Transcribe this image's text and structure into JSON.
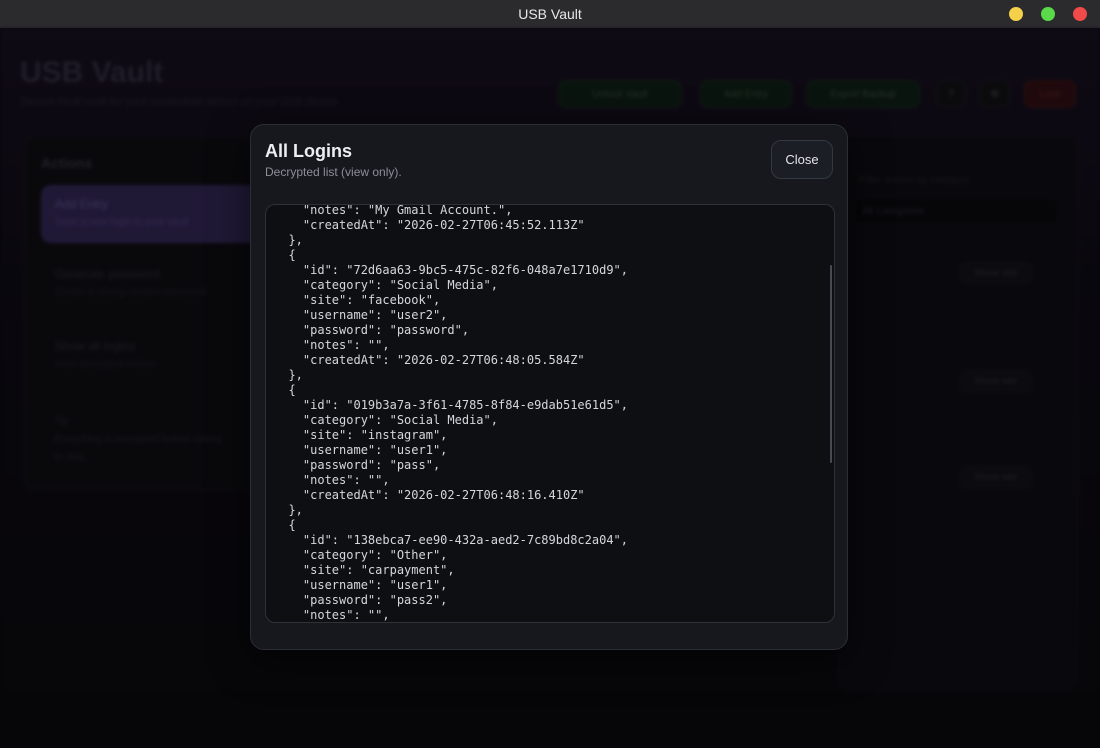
{
  "window": {
    "title": "USB Vault"
  },
  "background": {
    "brand": "USB Vault",
    "tagline": "Secure local vault for your credentials stored on your USB device",
    "header_buttons": [
      "Unlock Vault",
      "Add Entry",
      "Export Backup",
      "?",
      "⚙",
      "Lock"
    ],
    "left_panel": {
      "heading": "Actions",
      "active_item": {
        "title": "Add Entry",
        "subtitle": "Save a new login to your vault"
      },
      "items": [
        {
          "title": "Generate password",
          "subtitle": "Create a strong random password"
        },
        {
          "title": "Show all logins",
          "subtitle": "View decrypted entries"
        }
      ],
      "note": [
        "Tip",
        "Everything is encrypted before saving",
        "to disk."
      ]
    },
    "right_panel": {
      "hint": "Filter entries by category",
      "select_value": "All Categories",
      "buttons": [
        "Show site",
        "Show site",
        "Show site"
      ]
    }
  },
  "modal": {
    "title": "All Logins",
    "subtitle": "Decrypted list (view only).",
    "close_label": "Close",
    "code_lines": [
      "    \"notes\": \"My Gmail Account.\",",
      "    \"createdAt\": \"2026-02-27T06:45:52.113Z\"",
      "  },",
      "  {",
      "    \"id\": \"72d6aa63-9bc5-475c-82f6-048a7e1710d9\",",
      "    \"category\": \"Social Media\",",
      "    \"site\": \"facebook\",",
      "    \"username\": \"user2\",",
      "    \"password\": \"password\",",
      "    \"notes\": \"\",",
      "    \"createdAt\": \"2026-02-27T06:48:05.584Z\"",
      "  },",
      "  {",
      "    \"id\": \"019b3a7a-3f61-4785-8f84-e9dab51e61d5\",",
      "    \"category\": \"Social Media\",",
      "    \"site\": \"instagram\",",
      "    \"username\": \"user1\",",
      "    \"password\": \"pass\",",
      "    \"notes\": \"\",",
      "    \"createdAt\": \"2026-02-27T06:48:16.410Z\"",
      "  },",
      "  {",
      "    \"id\": \"138ebca7-ee90-432a-aed2-7c89bd8c2a04\",",
      "    \"category\": \"Other\",",
      "    \"site\": \"carpayment\",",
      "    \"username\": \"user1\",",
      "    \"password\": \"pass2\",",
      "    \"notes\": \"\","
    ]
  }
}
